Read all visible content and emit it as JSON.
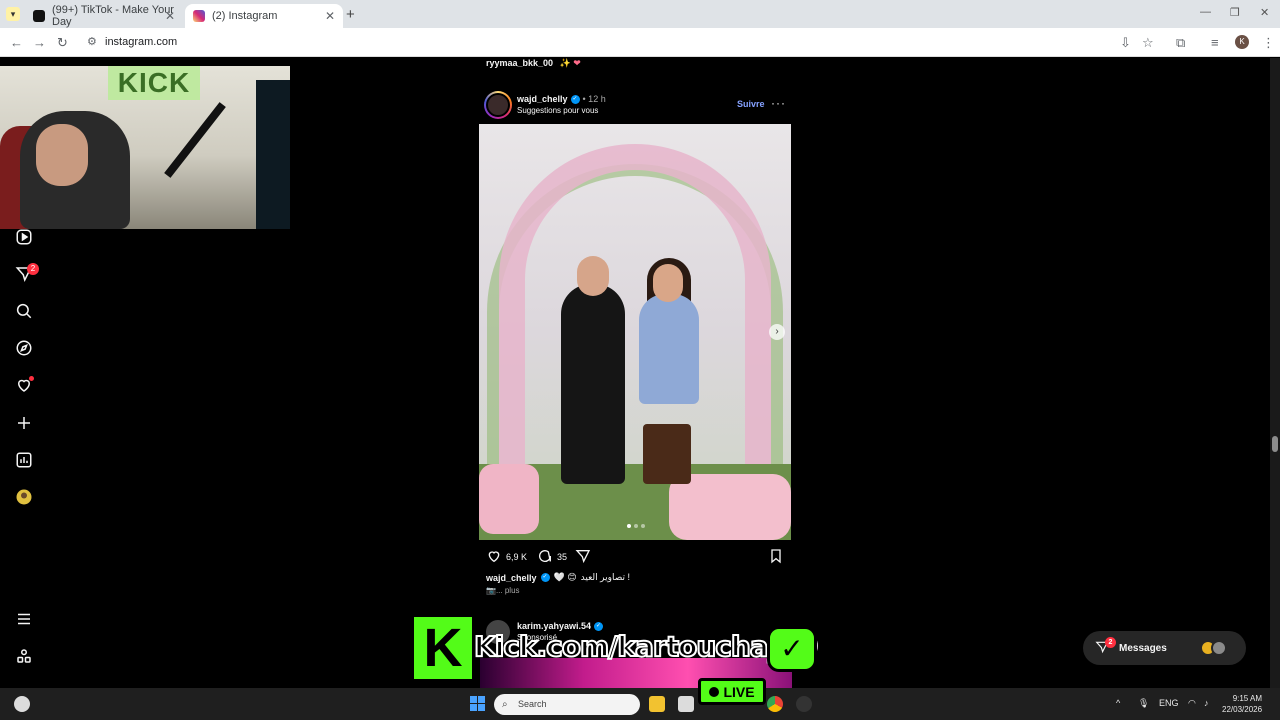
{
  "browser": {
    "tabs": [
      {
        "title": "(99+) TikTok - Make Your Day",
        "active": false
      },
      {
        "title": "(2) Instagram",
        "active": true
      }
    ],
    "url": "instagram.com"
  },
  "nav": {
    "reels_badge": "2"
  },
  "feed": {
    "previous_post_user": "ryymaa_bkk_00",
    "previous_post_emoji": "✨ ❤",
    "post": {
      "username": "wajd_chelly",
      "time": "• 12 h",
      "subtitle": "Suggestions pour vous",
      "follow_label": "Suivre",
      "more_label": "···",
      "likes": "6,9 K",
      "comments": "35",
      "caption_user": "wajd_chelly",
      "caption_emoji": "🤍 😊",
      "caption_text": "تصاوير العيد !",
      "caption_more": "📷... plus"
    },
    "next_post": {
      "username": "karim.yahyawi.54",
      "subtitle": "Sponsorisé"
    }
  },
  "overlay": {
    "kick_url": "Kick.com/kartoucha_09",
    "live_label": "LIVE",
    "kick_letter": "K"
  },
  "messages": {
    "label": "Messages",
    "badge": "2"
  },
  "taskbar": {
    "search_placeholder": "Search",
    "lang": "ENG",
    "time": "9:15 AM",
    "date": "22/03/2026"
  },
  "colors": {
    "accent_link": "#85a1ff",
    "notification": "#ff3040",
    "kick_green": "#53fc18"
  }
}
